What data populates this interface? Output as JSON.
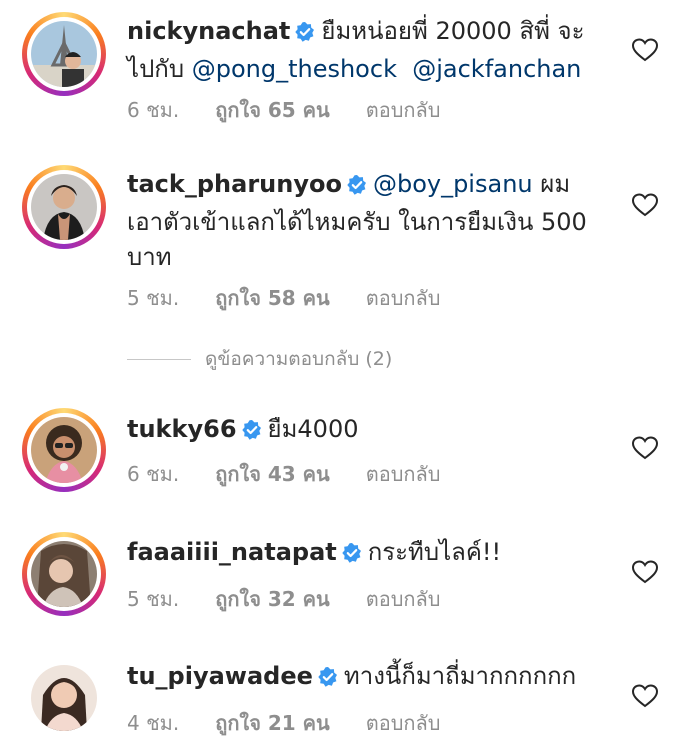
{
  "comments": [
    {
      "username": "nickynachat",
      "parts": [
        "ยืมหน่อยพี่ 20000 สิพี่ จะ",
        "ไปกับ"
      ],
      "mentions": [
        "@pong_theshock",
        "@jackfanchan"
      ],
      "time": "6 ชม.",
      "likes": "ถูกใจ 65 คน",
      "reply": "ตอบกลับ"
    },
    {
      "username": "tack_pharunyoo",
      "mention": "@boy_pisanu",
      "text": "ผม เอาตัวเข้าแลกได้ไหมครับ ในการยืมเงิน 500 บาท",
      "time": "5 ชม.",
      "likes": "ถูกใจ 58 คน",
      "reply": "ตอบกลับ"
    },
    {
      "username": "tukky66",
      "text": "ยืม4000",
      "time": "6 ชม.",
      "likes": "ถูกใจ 43 คน",
      "reply": "ตอบกลับ"
    },
    {
      "username": "faaaiiii_natapat",
      "text": "กระทืบไลค์!!",
      "time": "5 ชม.",
      "likes": "ถูกใจ 32 คน",
      "reply": "ตอบกลับ"
    },
    {
      "username": "tu_piyawadee",
      "text": "ทางนี้ก็มาถี่มากกกกกก",
      "time": "4 ชม.",
      "likes": "ถูกใจ 21 คน",
      "reply": "ตอบกลับ"
    }
  ],
  "view_replies": "ดูข้อความตอบกลับ (2)",
  "colors": {
    "meta": "#8e8e8e",
    "mention": "#00376b",
    "verified": "#3897f0"
  },
  "icons": {
    "verified": "verified-badge-icon",
    "like": "heart-outline-icon"
  }
}
